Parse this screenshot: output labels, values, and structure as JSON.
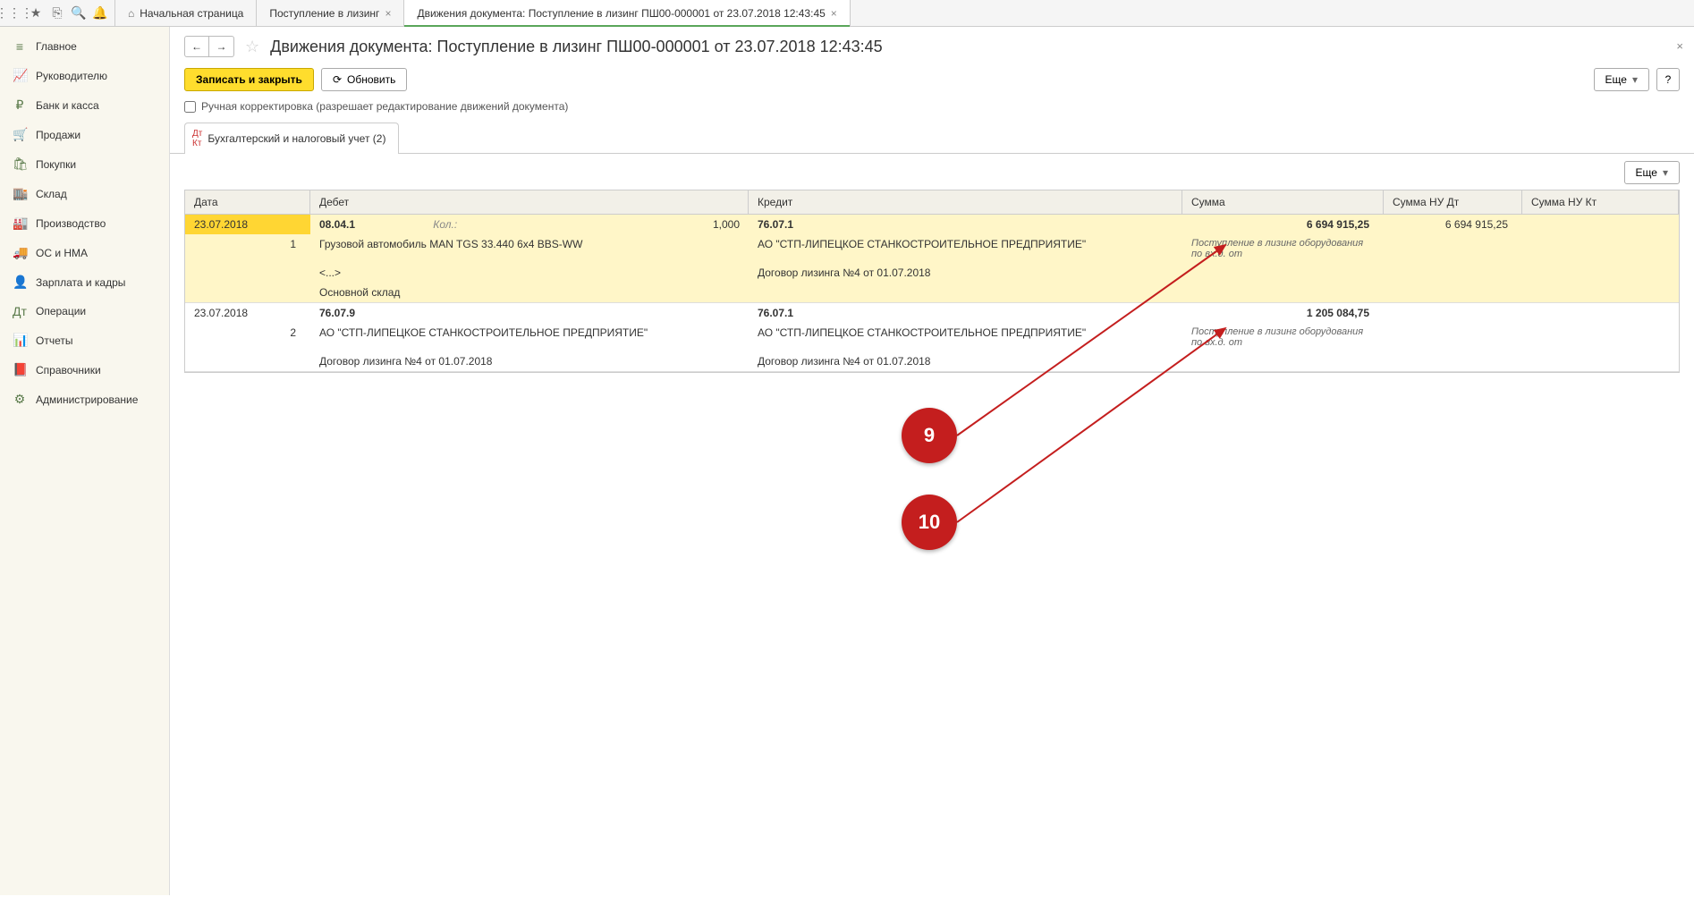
{
  "topTabs": {
    "home": "Начальная страница",
    "t1": "Поступление в лизинг",
    "t2": "Движения документа: Поступление в лизинг ПШ00-000001 от 23.07.2018 12:43:45"
  },
  "sidebar": [
    {
      "icon": "≡",
      "label": "Главное"
    },
    {
      "icon": "📈",
      "label": "Руководителю"
    },
    {
      "icon": "₽",
      "label": "Банк и касса"
    },
    {
      "icon": "🛒",
      "label": "Продажи"
    },
    {
      "icon": "🛍",
      "label": "Покупки"
    },
    {
      "icon": "🏬",
      "label": "Склад"
    },
    {
      "icon": "🏭",
      "label": "Производство"
    },
    {
      "icon": "🚚",
      "label": "ОС и НМА"
    },
    {
      "icon": "👤",
      "label": "Зарплата и кадры"
    },
    {
      "icon": "Дт",
      "label": "Операции"
    },
    {
      "icon": "📊",
      "label": "Отчеты"
    },
    {
      "icon": "📕",
      "label": "Справочники"
    },
    {
      "icon": "⚙",
      "label": "Администрирование"
    }
  ],
  "pageTitle": "Движения документа: Поступление в лизинг ПШ00-000001 от 23.07.2018 12:43:45",
  "actions": {
    "save": "Записать и закрыть",
    "refresh": "Обновить",
    "more": "Еще",
    "help": "?"
  },
  "manualEdit": "Ручная корректировка (разрешает редактирование движений документа)",
  "subtab": "Бухгалтерский и налоговый учет (2)",
  "columns": {
    "date": "Дата",
    "debit": "Дебет",
    "credit": "Кредит",
    "sum": "Сумма",
    "nudt": "Сумма НУ Дт",
    "nukt": "Сумма НУ Кт"
  },
  "rows": [
    {
      "n": "1",
      "date": "23.07.2018",
      "debitAcc": "08.04.1",
      "qtyLabel": "Кол.:",
      "qty": "1,000",
      "debitL2": "Грузовой автомобиль MAN TGS 33.440 6x4 BBS-WW",
      "debitL3": "<...>",
      "debitL4": "Основной склад",
      "creditAcc": "76.07.1",
      "creditL2": "АО \"СТП-ЛИПЕЦКОЕ СТАНКОСТРОИТЕЛЬНОЕ ПРЕДПРИЯТИЕ\"",
      "creditL3": "Договор лизинга №4 от 01.07.2018",
      "sum": "6 694 915,25",
      "sumDesc": "Поступление в лизинг оборудования по вх.д.  от",
      "nudt": "6 694 915,25",
      "nukt": ""
    },
    {
      "n": "2",
      "date": "23.07.2018",
      "debitAcc": "76.07.9",
      "qtyLabel": "",
      "qty": "",
      "debitL2": "АО \"СТП-ЛИПЕЦКОЕ СТАНКОСТРОИТЕЛЬНОЕ ПРЕДПРИЯТИЕ\"",
      "debitL3": "Договор лизинга №4 от 01.07.2018",
      "debitL4": "",
      "creditAcc": "76.07.1",
      "creditL2": "АО \"СТП-ЛИПЕЦКОЕ СТАНКОСТРОИТЕЛЬНОЕ ПРЕДПРИЯТИЕ\"",
      "creditL3": "Договор лизинга №4 от 01.07.2018",
      "sum": "1 205 084,75",
      "sumDesc": "Поступление в лизинг оборудования по вх.д.  от",
      "nudt": "",
      "nukt": ""
    }
  ],
  "annotations": {
    "a9": "9",
    "a10": "10"
  }
}
